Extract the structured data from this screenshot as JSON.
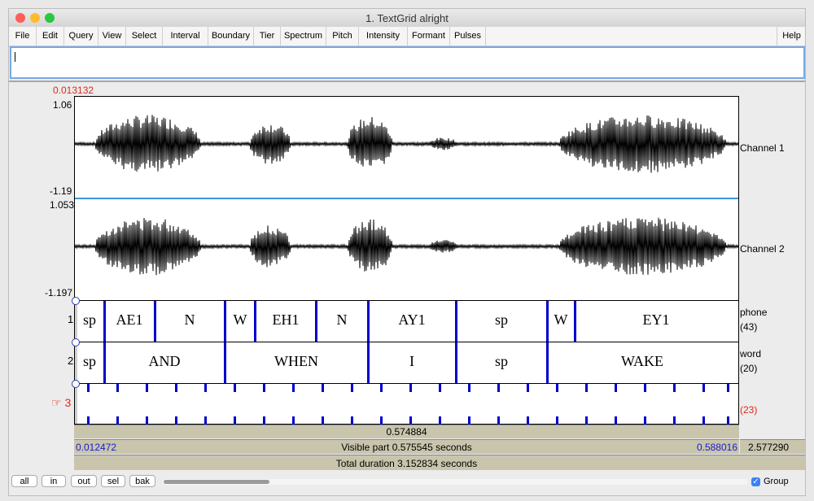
{
  "window": {
    "title": "1. TextGrid alright"
  },
  "menu": [
    "File",
    "Edit",
    "Query",
    "View",
    "Select",
    "Interval",
    "Boundary",
    "Tier",
    "Spectrum",
    "Pitch",
    "Intensity",
    "Formant",
    "Pulses"
  ],
  "help_label": "Help",
  "cursor_time": "0.013132",
  "channels": [
    {
      "name": "Channel 1",
      "max": "1.06",
      "min": "-1.19"
    },
    {
      "name": "Channel 2",
      "max": "1.053",
      "min": "-1.197"
    }
  ],
  "tiers": [
    {
      "number": "1",
      "name": "phone",
      "count": "(43)",
      "intervals": [
        "sp",
        "AE1",
        "N",
        "W",
        "EH1",
        "N",
        "AY1",
        "sp",
        "W",
        "EY1"
      ]
    },
    {
      "number": "2",
      "name": "word",
      "count": "(20)",
      "intervals": [
        "sp",
        "AND",
        "WHEN",
        "I",
        "sp",
        "WAKE"
      ]
    },
    {
      "number": "3",
      "name": "",
      "count": "(23)",
      "intervals": []
    }
  ],
  "selection_duration": "0.574884",
  "visible": {
    "start": "0.012472",
    "label": "Visible part 0.575545 seconds",
    "end": "0.588016",
    "after": "2.577290"
  },
  "total_duration": "Total duration 3.152834 seconds",
  "buttons": {
    "all": "all",
    "in": "in",
    "out": "out",
    "sel": "sel",
    "bak": "bak"
  },
  "group": {
    "label": "Group",
    "checked": true
  },
  "colors": {
    "accent": "#0000ff",
    "cursor": "#e0271a",
    "tier_bar": "#c9c5ad",
    "boundary": "#0000cc"
  }
}
